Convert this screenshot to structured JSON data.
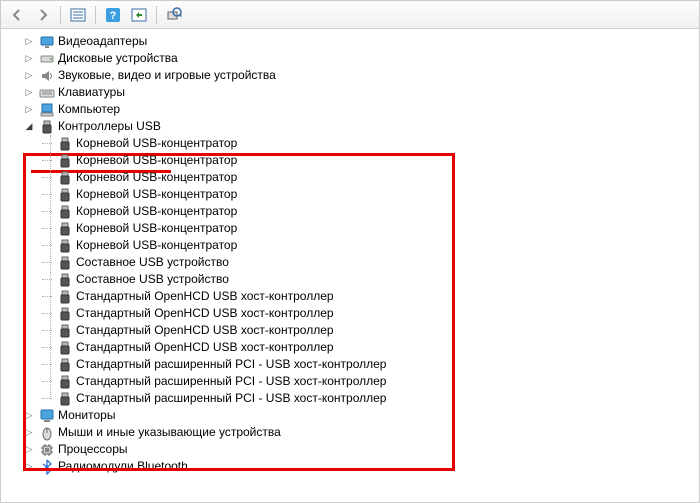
{
  "toolbar": {
    "back": "Назад",
    "forward": "Вперед",
    "details": "Показать скрытые устройства",
    "help": "Справка",
    "refresh": "Обновить",
    "scan": "Обновить конфигурацию оборудования"
  },
  "tree": [
    {
      "label": "Видеоадаптеры",
      "icon": "display",
      "expanded": false,
      "level": 0
    },
    {
      "label": "Дисковые устройства",
      "icon": "disk",
      "expanded": false,
      "level": 0
    },
    {
      "label": "Звуковые, видео и игровые устройства",
      "icon": "audio",
      "expanded": false,
      "level": 0
    },
    {
      "label": "Клавиатуры",
      "icon": "keyboard",
      "expanded": false,
      "level": 0
    },
    {
      "label": "Компьютер",
      "icon": "computer",
      "expanded": false,
      "level": 0
    },
    {
      "label": "Контроллеры USB",
      "icon": "usb",
      "expanded": true,
      "level": 0,
      "children": [
        {
          "label": "Корневой USB-концентратор",
          "icon": "usb"
        },
        {
          "label": "Корневой USB-концентратор",
          "icon": "usb"
        },
        {
          "label": "Корневой USB-концентратор",
          "icon": "usb"
        },
        {
          "label": "Корневой USB-концентратор",
          "icon": "usb"
        },
        {
          "label": "Корневой USB-концентратор",
          "icon": "usb"
        },
        {
          "label": "Корневой USB-концентратор",
          "icon": "usb"
        },
        {
          "label": "Корневой USB-концентратор",
          "icon": "usb"
        },
        {
          "label": "Составное USB устройство",
          "icon": "usb"
        },
        {
          "label": "Составное USB устройство",
          "icon": "usb"
        },
        {
          "label": "Стандартный OpenHCD USB хост-контроллер",
          "icon": "usb"
        },
        {
          "label": "Стандартный OpenHCD USB хост-контроллер",
          "icon": "usb"
        },
        {
          "label": "Стандартный OpenHCD USB хост-контроллер",
          "icon": "usb"
        },
        {
          "label": "Стандартный OpenHCD USB хост-контроллер",
          "icon": "usb"
        },
        {
          "label": "Стандартный расширенный PCI - USB хост-контроллер",
          "icon": "usb"
        },
        {
          "label": "Стандартный расширенный PCI - USB хост-контроллер",
          "icon": "usb"
        },
        {
          "label": "Стандартный расширенный PCI - USB хост-контроллер",
          "icon": "usb"
        }
      ]
    },
    {
      "label": "Мониторы",
      "icon": "monitor",
      "expanded": false,
      "level": 0
    },
    {
      "label": "Мыши и иные указывающие устройства",
      "icon": "mouse",
      "expanded": false,
      "level": 0
    },
    {
      "label": "Процессоры",
      "icon": "cpu",
      "expanded": false,
      "level": 0
    },
    {
      "label": "Радиомодули Bluetooth",
      "icon": "bluetooth",
      "expanded": false,
      "level": 0
    }
  ]
}
